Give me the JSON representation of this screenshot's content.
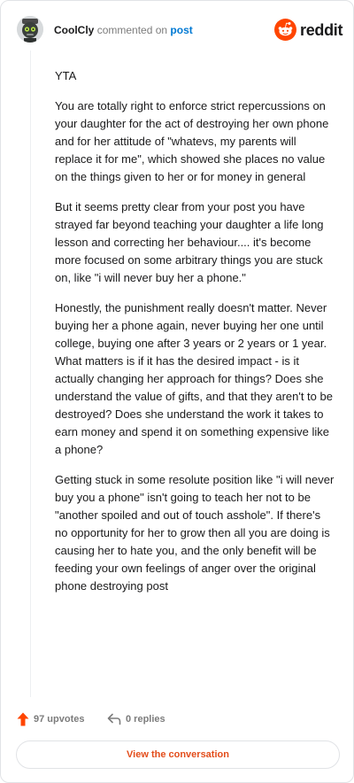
{
  "header": {
    "author": "CoolCly",
    "action": "commented on",
    "post_link": "post",
    "brand": "reddit",
    "avatar_icon": "robot-avatar-icon",
    "brand_icon": "reddit-snoo-icon",
    "brand_color": "#ff4500"
  },
  "comment": {
    "paragraphs": [
      "YTA",
      "You are totally right to enforce strict repercussions on your daughter for the act of destroying her own phone and for her attitude of \"whatevs, my parents will replace it for me\", which showed she places no value on the things given to her or for money in general",
      "But it seems pretty clear from your post you have strayed far beyond teaching your daughter a life long lesson and correcting her behaviour.... it's become more focused on some arbitrary things you are stuck on, like \"i will never buy her a phone.\"",
      "Honestly, the punishment really doesn't matter. Never buying her a phone again, never buying her one until college, buying one after 3 years or 2 years or 1 year. What matters is if it has the desired impact - is it actually changing her approach for things? Does she understand the value of gifts, and that they aren't to be destroyed? Does she understand the work it takes to earn money and spend it on something expensive like a phone?",
      "Getting stuck in some resolute position like \"i will never buy you a phone\" isn't going to teach her not to be \"another spoiled and out of touch asshole\". If there's no opportunity for her to grow then all you are doing is causing her to hate you, and the only benefit will be feeding your own feelings of anger over the original phone destroying post"
    ]
  },
  "footer": {
    "upvotes": "97 upvotes",
    "replies": "0 replies",
    "upvote_icon": "upvote-arrow-icon",
    "reply_icon": "reply-arrow-icon",
    "upvote_color": "#ff4500"
  },
  "cta": {
    "label": "View the conversation",
    "color": "#e34c1a"
  }
}
